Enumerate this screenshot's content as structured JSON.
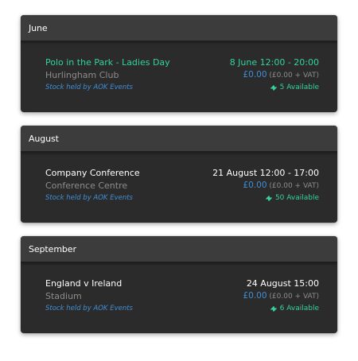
{
  "colors": {
    "card_bg": "#2b2b2b",
    "header_bg": "#3c3c3c",
    "accent_green": "#34d39b",
    "accent_blue": "#3f8fd6",
    "muted_text": "#8d8d8d"
  },
  "sections": [
    {
      "month": "June",
      "event": {
        "title": "Polo in the Park - Ladies Day",
        "venue": "Hurlingham Club",
        "stock": "Stock held by AOK Events",
        "datetime": "8 June  12:00 - 20:00",
        "price": "£0.00",
        "price_vat": " (£0.00 + VAT)",
        "availability": "5 Available",
        "availability_icon": "ticket-icon"
      }
    },
    {
      "month": "August",
      "event": {
        "title": "Company Conference",
        "venue": "Conference Centre",
        "stock": "Stock held by AOK Events",
        "datetime": "21 August  12:00 - 17:00",
        "price": "£0.00",
        "price_vat": " (£0.00 + VAT)",
        "availability": "50 Available",
        "availability_icon": "ticket-icon"
      }
    },
    {
      "month": "September",
      "event": {
        "title": "England v Ireland",
        "venue": "Stadium",
        "stock": "Stock held by AOK Events",
        "datetime": "24 August  15:00",
        "price": "£0.00",
        "price_vat": " (£0.00 + VAT)",
        "availability": "6 Available",
        "availability_icon": "ticket-icon"
      }
    }
  ]
}
